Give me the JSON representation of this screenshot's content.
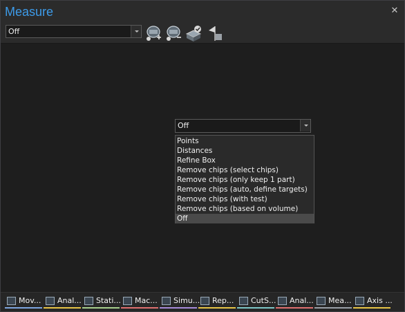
{
  "window": {
    "title": "Measure"
  },
  "toolbar": {
    "mode_select": {
      "value": "Off"
    },
    "buttons": [
      {
        "icon": "measure-add-icon"
      },
      {
        "icon": "measure-remove-icon"
      },
      {
        "icon": "measure-check-icon"
      },
      {
        "icon": "flag-icon"
      }
    ]
  },
  "dropdown": {
    "value": "Off",
    "options": [
      "Points",
      "Distances",
      "Refine Box",
      "Remove chips (select chips)",
      "Remove chips (only keep 1 part)",
      "Remove chips (auto, define targets)",
      "Remove chips (with test)",
      "Remove chips (based on volume)",
      "Off"
    ],
    "selected_index": 8
  },
  "tabs": [
    {
      "label": "Mov...",
      "color": "#7ea6e0"
    },
    {
      "label": "Anal...",
      "color": "#e8c547"
    },
    {
      "label": "Stati...",
      "color": "#a8d08d"
    },
    {
      "label": "Mac...",
      "color": "#e07070"
    },
    {
      "label": "Simu...",
      "color": "#a78bda"
    },
    {
      "label": "Rep...",
      "color": "#e8c547"
    },
    {
      "label": "CutS...",
      "color": "#7ec8c8"
    },
    {
      "label": "Anal...",
      "color": "#e07070"
    },
    {
      "label": "Mea...",
      "color": "#9aa0a8"
    },
    {
      "label": "Axis ...",
      "color": "#e8c547"
    }
  ]
}
